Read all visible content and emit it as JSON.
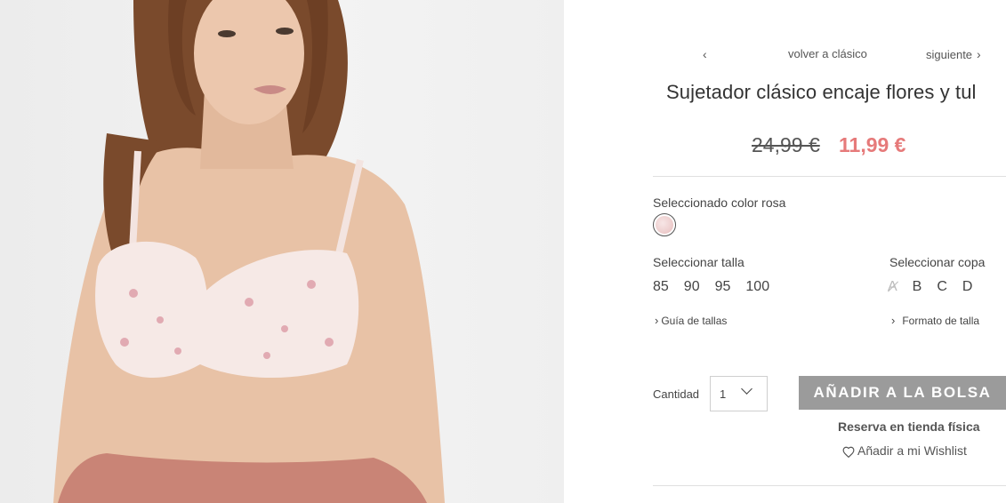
{
  "nav": {
    "prev_icon": "chevron-left-icon",
    "back_label": "volver a clásico",
    "next_label": "siguiente",
    "next_icon": "chevron-right-icon"
  },
  "product": {
    "title": "Sujetador clásico encaje flores y tul",
    "price_old": "24,99 €",
    "price_new": "11,99 €",
    "price_new_color": "#e67a7a"
  },
  "color": {
    "label": "Seleccionado color rosa",
    "swatch": "rosa"
  },
  "size": {
    "label": "Seleccionar talla",
    "options": [
      "85",
      "90",
      "95",
      "100"
    ]
  },
  "cup": {
    "label": "Seleccionar copa",
    "options": [
      {
        "label": "A",
        "available": false
      },
      {
        "label": "B",
        "available": true
      },
      {
        "label": "C",
        "available": true
      },
      {
        "label": "D",
        "available": true
      }
    ]
  },
  "links": {
    "size_guide": "Guía de tallas",
    "size_format": "Formato de talla"
  },
  "quantity": {
    "label": "Cantidad",
    "value": "1"
  },
  "actions": {
    "add_to_bag": "AÑADIR A LA BOLSA",
    "add_to_bag_color": "#9b9b9b",
    "reserve": "Reserva en tienda física",
    "wishlist": "Añadir a mi Wishlist",
    "wishlist_icon": "heart-icon"
  }
}
